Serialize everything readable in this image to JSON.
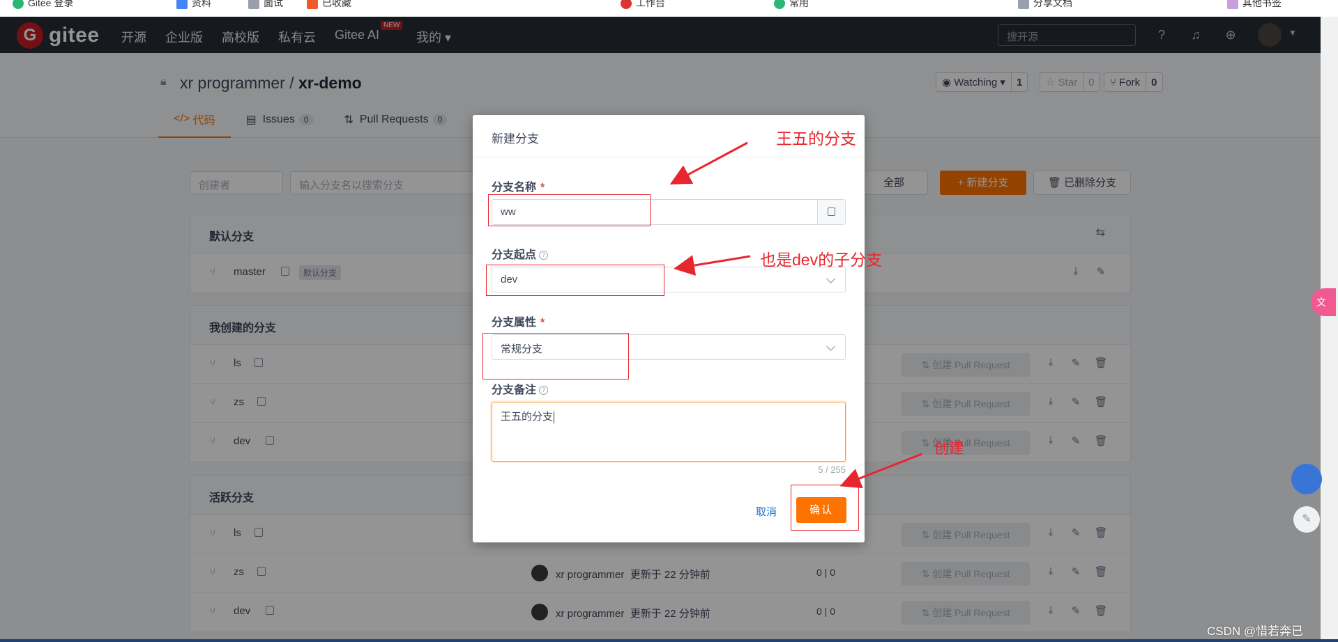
{
  "browser": {
    "bookmarks": [
      "Gitee 登录",
      "资料",
      "面试",
      "已收藏",
      "常用",
      "分享文档",
      "工作台",
      "其他书签"
    ]
  },
  "nav": {
    "logo_text": "gitee",
    "links": [
      "开源",
      "企业版",
      "高校版",
      "私有云",
      "Gitee AI",
      "我的 ▾"
    ],
    "new_badge": "NEW",
    "search_placeholder": "搜开源"
  },
  "repo": {
    "owner": "xr programmer",
    "separator": "/",
    "name": "xr-demo",
    "watching_label": "Watching ▾",
    "watching_count": "1",
    "star_label": "Star",
    "star_count": "0",
    "fork_label": "Fork",
    "fork_count": "0",
    "tabs": [
      {
        "label": "代码",
        "badge": ""
      },
      {
        "label": "Issues",
        "badge": "0"
      },
      {
        "label": "Pull Requests",
        "badge": "0"
      }
    ]
  },
  "filters": {
    "creator_placeholder": "创建者",
    "search_placeholder": "输入分支名以搜索分支",
    "all_label": "全部",
    "new_branch_label": "+  新建分支",
    "deleted_label": "已删除分支"
  },
  "panels": {
    "default": {
      "title": "默认分支",
      "branch": "master",
      "badge": "默认分支"
    },
    "mine": {
      "title": "我创建的分支",
      "branches": [
        "ls",
        "zs",
        "dev"
      ]
    },
    "active": {
      "title": "活跃分支",
      "branches": [
        "ls",
        "zs",
        "dev"
      ],
      "author": "xr programmer",
      "updated": "更新于 22 分钟前",
      "counts": "0 | 0"
    },
    "pr_label": "创建 Pull Request"
  },
  "modal": {
    "title": "新建分支",
    "name_label": "分支名称",
    "name_value": "ww",
    "start_label": "分支起点",
    "start_value": "dev",
    "attr_label": "分支属性",
    "attr_value": "常规分支",
    "note_label": "分支备注",
    "note_value": "王五的分支",
    "counter": "5 / 255",
    "cancel_label": "取消",
    "confirm_label": "确认",
    "required_mark": "*",
    "help_mark": "?"
  },
  "annotations": {
    "name_note": "王五的分支",
    "start_note": "也是dev的子分支",
    "confirm_note": "创建",
    "color": "#e8262d"
  },
  "watermark": "CSDN @惜若奔已",
  "colors": {
    "accent": "#fe7300",
    "nav_bg": "#262b35",
    "brand": "#c71d23"
  }
}
